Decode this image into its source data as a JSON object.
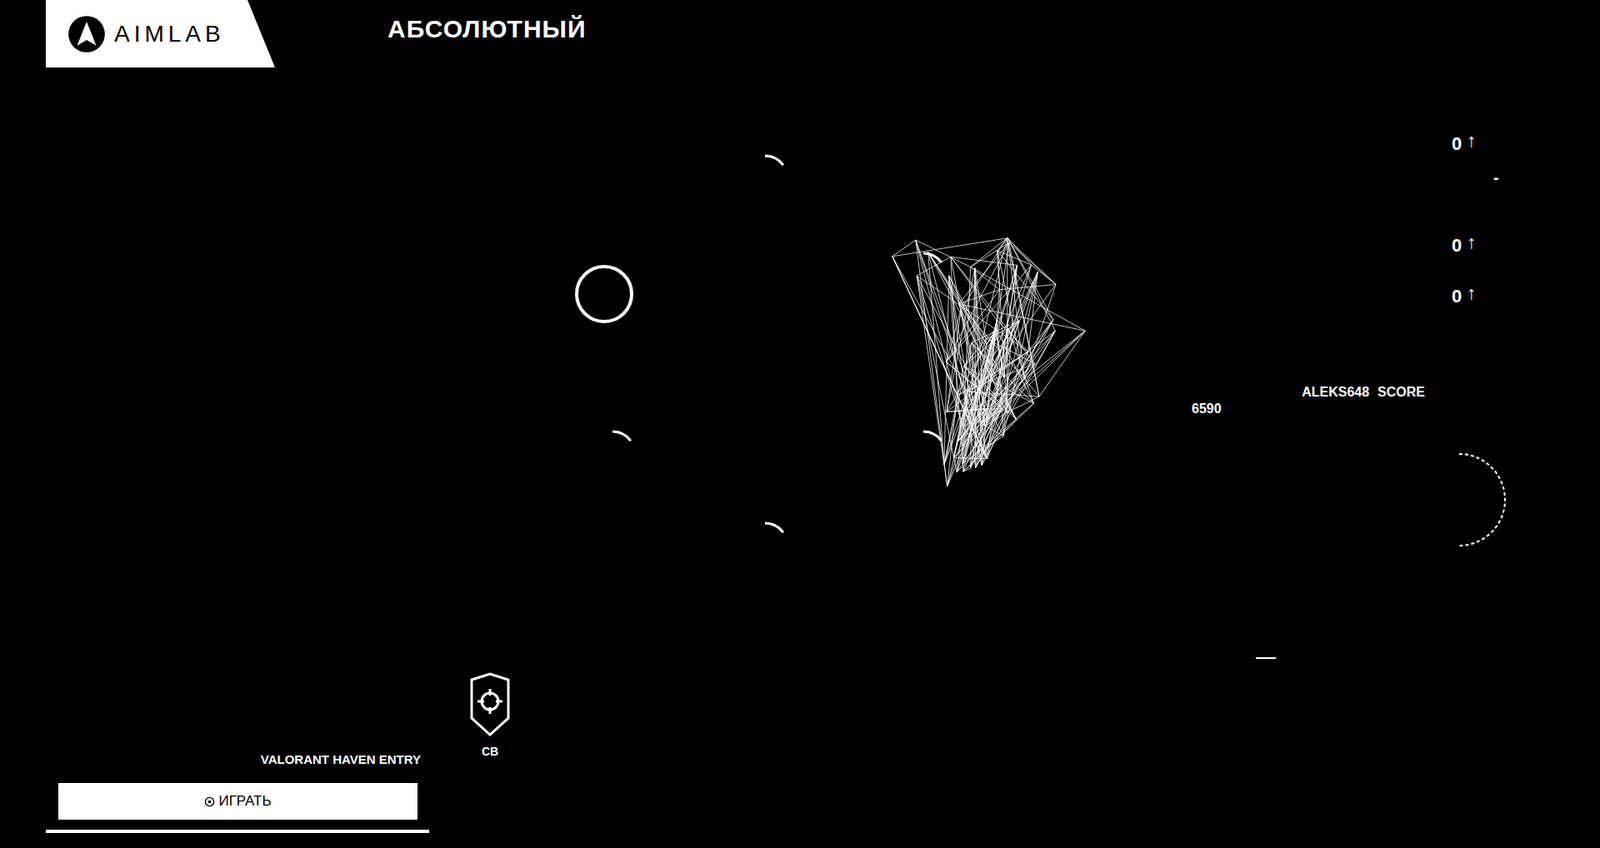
{
  "logo": {
    "text": "AIMLAB"
  },
  "title": "АБСОЛЮТНЫЙ",
  "stats": [
    {
      "value": "0",
      "arrow": "↑"
    },
    {
      "value": "0",
      "arrow": "↑"
    },
    {
      "value": "0",
      "arrow": "↑"
    }
  ],
  "stats_dash": "-",
  "player": {
    "name": "ALEKS648",
    "label": "SCORE",
    "score": "6590"
  },
  "rank": {
    "label": "CB"
  },
  "task": {
    "name": "VALORANT HAVEN ENTRY",
    "button": "ИГРАТЬ"
  },
  "targets": [
    {
      "kind": "ring",
      "level": 1
    },
    {
      "kind": "arc",
      "level": 0.15
    },
    {
      "kind": "arc",
      "level": 0.15
    },
    {
      "kind": "arc",
      "level": 0.15
    },
    {
      "kind": "arc",
      "level": 0.15
    },
    {
      "kind": "arc",
      "level": 0.15
    }
  ]
}
